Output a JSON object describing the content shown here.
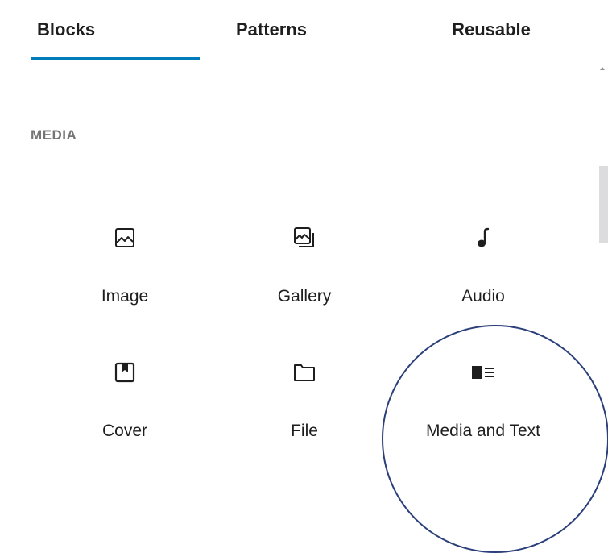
{
  "tabs": [
    {
      "label": "Blocks",
      "active": true
    },
    {
      "label": "Patterns",
      "active": false
    },
    {
      "label": "Reusable",
      "active": false
    }
  ],
  "accent_color": "#007cba",
  "section": {
    "title": "MEDIA"
  },
  "blocks": [
    {
      "label": "Image",
      "icon": "image-icon"
    },
    {
      "label": "Gallery",
      "icon": "gallery-icon"
    },
    {
      "label": "Audio",
      "icon": "audio-icon"
    },
    {
      "label": "Cover",
      "icon": "cover-icon"
    },
    {
      "label": "File",
      "icon": "file-icon"
    },
    {
      "label": "Media and Text",
      "icon": "media-and-text-icon"
    }
  ],
  "annotation_color": "#2b3f7a"
}
